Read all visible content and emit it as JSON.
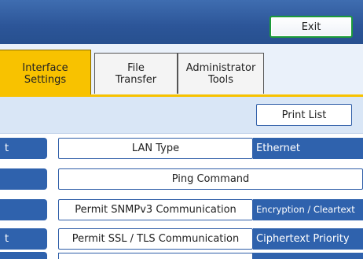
{
  "header": {
    "exit_label": "Exit"
  },
  "tabs": [
    {
      "label": "Interface\nSettings",
      "active": true
    },
    {
      "label": "File\nTransfer",
      "active": false
    },
    {
      "label": "Administrator\nTools",
      "active": false
    }
  ],
  "toolbar": {
    "print_list_label": "Print List"
  },
  "settings": [
    {
      "stub": "t",
      "label": "LAN Type",
      "value": "Ethernet"
    },
    {
      "stub": "",
      "label": "Ping Command",
      "value": ""
    },
    {
      "stub": "",
      "label": "Permit SNMPv3 Communication",
      "value": "Encryption / Cleartext"
    },
    {
      "stub": "t",
      "label": "Permit SSL / TLS Communication",
      "value": "Ciphertext Priority"
    }
  ],
  "colors": {
    "header_blue": "#2c5598",
    "active_tab": "#f8c200",
    "exit_border": "#1c9b3a",
    "row_blue": "#2f62ad"
  }
}
